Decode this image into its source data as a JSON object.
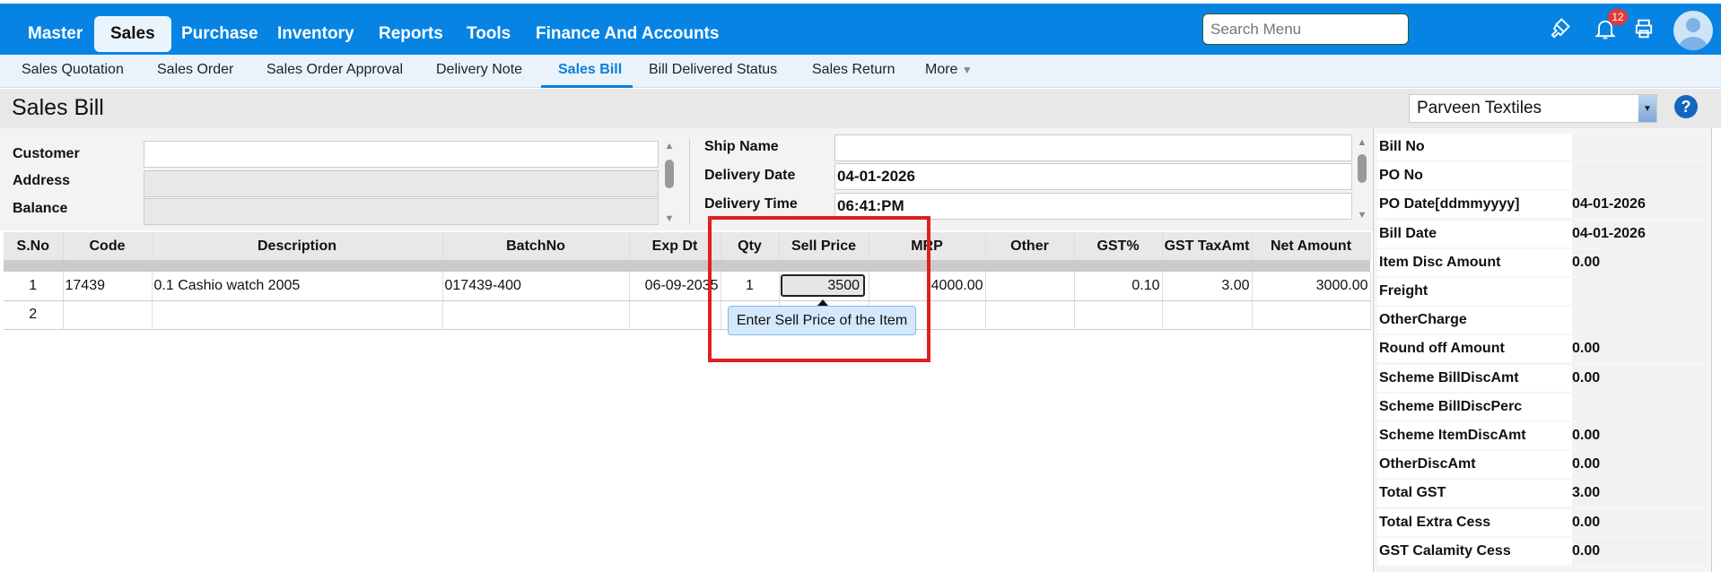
{
  "topnav": {
    "items": [
      "Master",
      "Sales",
      "Purchase",
      "Inventory",
      "Reports",
      "Tools",
      "Finance And Accounts"
    ],
    "active": "Sales",
    "search_placeholder": "Search Menu",
    "notification_count": "12",
    "icons": [
      "brush-icon",
      "bell-icon",
      "printer-icon",
      "avatar-icon"
    ],
    "accent": "#0784e3"
  },
  "subnav": {
    "items": [
      "Sales Quotation",
      "Sales Order",
      "Sales Order Approval",
      "Delivery Note",
      "Sales Bill",
      "Bill Delivered Status",
      "Sales Return",
      "More"
    ],
    "active": "Sales Bill"
  },
  "page": {
    "title": "Sales Bill",
    "company": "Parveen Textiles",
    "help": "?"
  },
  "form": {
    "customer_label": "Customer",
    "customer": "",
    "address_label": "Address",
    "address": "",
    "balance_label": "Balance",
    "balance": "",
    "ship_name_label": "Ship Name",
    "ship_name": "",
    "delivery_date_label": "Delivery Date",
    "delivery_date": "04-01-2026",
    "delivery_time_label": "Delivery Time",
    "delivery_time": "06:41:PM"
  },
  "table": {
    "headers": [
      "S.No",
      "Code",
      "Description",
      "BatchNo",
      "Exp Dt",
      "Qty",
      "Sell Price",
      "MRP",
      "Other",
      "GST%",
      "GST TaxAmt",
      "Net Amount"
    ],
    "rows": [
      [
        "1",
        "17439",
        "0.1 Cashio watch 2005",
        "017439-400",
        "06-09-2035",
        "1",
        "3500",
        "4000.00",
        "",
        "0.10",
        "3.00",
        "3000.00"
      ],
      [
        "2",
        "",
        "",
        "",
        "",
        "",
        "",
        "",
        "",
        "",
        "",
        ""
      ]
    ],
    "tooltip": "Enter Sell Price of the Item"
  },
  "summary": [
    [
      "Bill No",
      ""
    ],
    [
      "PO No",
      ""
    ],
    [
      "PO Date[ddmmyyyy]",
      "04-01-2026"
    ],
    [
      "Bill Date",
      "04-01-2026"
    ],
    [
      "Item Disc Amount",
      "0.00"
    ],
    [
      "Freight",
      ""
    ],
    [
      "OtherCharge",
      ""
    ],
    [
      "Round off Amount",
      "0.00"
    ],
    [
      "Scheme BillDiscAmt",
      "0.00"
    ],
    [
      "Scheme BillDiscPerc",
      ""
    ],
    [
      "Scheme ItemDiscAmt",
      "0.00"
    ],
    [
      "OtherDiscAmt",
      "0.00"
    ],
    [
      "Total GST",
      "3.00"
    ],
    [
      "Total Extra Cess",
      "0.00"
    ],
    [
      "GST Calamity Cess",
      "0.00"
    ]
  ]
}
